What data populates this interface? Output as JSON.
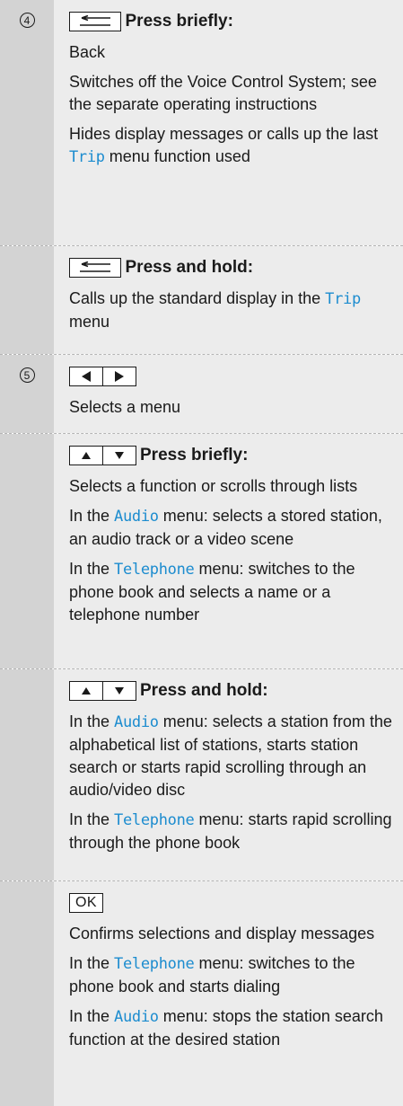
{
  "rows": [
    {
      "num": "4",
      "key_label": "Press briefly:",
      "lines": [
        "Back",
        "Switches off the Voice Control System; see the separate operating instructions",
        {
          "pre": "Hides display messages or calls up the last ",
          "mono": "Trip",
          "post": " menu function used"
        }
      ]
    },
    {
      "key_label": "Press and hold:",
      "lines": [
        {
          "pre": "Calls up the standard display in the ",
          "mono": "Trip",
          "post": " menu"
        }
      ]
    },
    {
      "num": "5",
      "lines": [
        "Selects a menu"
      ]
    },
    {
      "key_label": "Press briefly:",
      "lines": [
        "Selects a function or scrolls through lists",
        {
          "pre": "In the ",
          "mono": "Audio",
          "post": " menu: selects a stored station, an audio track or a video scene"
        },
        {
          "pre": "In the ",
          "mono": "Telephone",
          "post": " menu: switches to the phone book and selects a name or a telephone number"
        }
      ]
    },
    {
      "key_label": "Press and hold:",
      "lines": [
        {
          "pre": "In the ",
          "mono": "Audio",
          "post": " menu: selects a station from the alphabetical list of stations, starts station search or starts rapid scrolling through an audio/video disc"
        },
        {
          "pre": "In the ",
          "mono": "Telephone",
          "post": " menu: starts rapid scrolling through the phone book"
        }
      ]
    },
    {
      "key_label": "OK",
      "lines": [
        "Confirms selections and display messages",
        {
          "pre": "In the ",
          "mono": "Telephone",
          "post": " menu: switches to the phone book and starts dialing"
        },
        {
          "pre": "In the ",
          "mono": "Audio",
          "post": " menu: stops the station search function at the desired station"
        }
      ]
    }
  ]
}
